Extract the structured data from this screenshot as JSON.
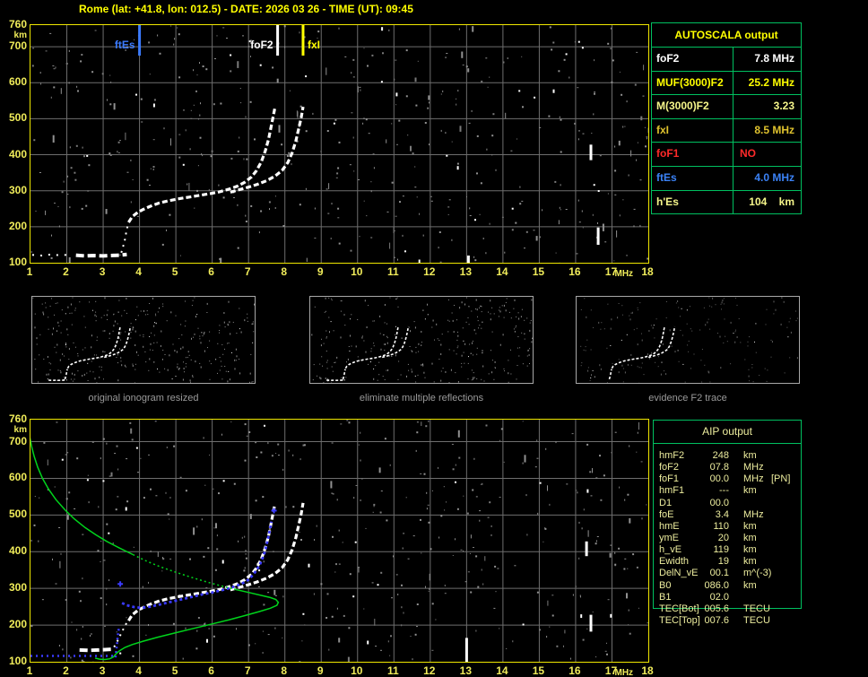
{
  "title": "Rome (lat: +41.8, lon: 012.5) - DATE: 2026 03 26 - TIME (UT): 09:45",
  "colors": {
    "accent_yellow": "#ffff00",
    "tick_yellow": "#f0ec5a",
    "plot_border_yellow": "#f0e800",
    "grid_gray": "#6e6e6e",
    "border_green": "#00c060",
    "pale_yellow": "#eded9e",
    "marker_blue": "#3b7bff",
    "trace_white": "#ffffff",
    "restored_blue": "#3a3aff",
    "profile_green": "#00d41c",
    "caption_gray": "#9a9a9a",
    "fof1_red": "#ff2a2a"
  },
  "autoscala": {
    "title": "AUTOSCALA output",
    "rows": [
      {
        "label": "foF2",
        "value": "7.8 MHz",
        "color": "#ffffff"
      },
      {
        "label": "MUF(3000)F2",
        "value": "25.2 MHz",
        "color": "#ffff00"
      },
      {
        "label": "M(3000)F2",
        "value": "3.23",
        "color": "#f5f58a"
      },
      {
        "label": "fxI",
        "value": "8.5 MHz",
        "color": "#dfc22e"
      },
      {
        "label": "foF1",
        "value": "NO",
        "color": "#ff2a2a"
      },
      {
        "label": "ftEs",
        "value": "4.0 MHz",
        "color": "#3b82f6"
      },
      {
        "label": "h'Es",
        "value": "104    km",
        "color": "#f5f58a"
      }
    ]
  },
  "thumbnails": [
    {
      "caption": "original ionogram resized"
    },
    {
      "caption": "eliminate multiple reflections"
    },
    {
      "caption": "evidence F2 trace"
    }
  ],
  "aip": {
    "title": "AIP output",
    "rows": [
      {
        "label": "hmF2",
        "value": "248",
        "unit": "km",
        "note": ""
      },
      {
        "label": "foF2",
        "value": "07.8",
        "unit": "MHz",
        "note": ""
      },
      {
        "label": "foF1",
        "value": "00.0",
        "unit": "MHz",
        "note": "[PN]"
      },
      {
        "label": "hmF1",
        "value": "---",
        "unit": "km",
        "note": ""
      },
      {
        "label": "D1",
        "value": "00.0",
        "unit": "",
        "note": ""
      },
      {
        "label": "foE",
        "value": "3.4",
        "unit": "MHz",
        "note": ""
      },
      {
        "label": "hmE",
        "value": "110",
        "unit": "km",
        "note": ""
      },
      {
        "label": "ymE",
        "value": "20",
        "unit": "km",
        "note": ""
      },
      {
        "label": "h_vE",
        "value": "119",
        "unit": "km",
        "note": ""
      },
      {
        "label": "Ewidth",
        "value": "19",
        "unit": "km",
        "note": ""
      },
      {
        "label": "DelN_vE",
        "value": "00.1",
        "unit": "m^(-3)",
        "note": ""
      },
      {
        "label": "B0",
        "value": "086.0",
        "unit": "km",
        "note": ""
      },
      {
        "label": "B1",
        "value": "02.0",
        "unit": "",
        "note": ""
      },
      {
        "label": "TEC[Bot]",
        "value": "005.6",
        "unit": "TECU",
        "note": ""
      },
      {
        "label": "TEC[Top]",
        "value": "007.6",
        "unit": "TECU",
        "note": ""
      }
    ]
  },
  "chart_data": [
    {
      "type": "scatter",
      "title": "recorded ionogram",
      "xlabel": "MHz",
      "ylabel": "km",
      "xlim": [
        1,
        18
      ],
      "ylim": [
        100,
        760
      ],
      "x_ticks": [
        1,
        2,
        3,
        4,
        5,
        6,
        7,
        8,
        9,
        10,
        11,
        12,
        13,
        14,
        15,
        16,
        17,
        18
      ],
      "y_ticks": [
        760,
        700,
        600,
        500,
        400,
        300,
        200,
        100
      ],
      "grid": true,
      "markers": [
        {
          "label": "ftEs",
          "freq": 4.0,
          "color": "#3b7bff",
          "label_side": "left"
        },
        {
          "label": "foF2",
          "freq": 7.8,
          "color": "#ffffff",
          "label_side": "left"
        },
        {
          "label": "fxI",
          "freq": 8.5,
          "color": "#ffff00",
          "label_side": "right"
        }
      ],
      "series": [
        {
          "name": "Es-sparse",
          "color": "#ffffff",
          "points": [
            [
              1.05,
              122
            ],
            [
              1.3,
              120
            ],
            [
              1.55,
              123
            ],
            [
              1.8,
              121
            ],
            [
              2.05,
              122
            ]
          ]
        },
        {
          "name": "Es-trace",
          "color": "#ffffff",
          "points": [
            [
              2.25,
              121
            ],
            [
              2.5,
              119
            ],
            [
              2.75,
              120
            ],
            [
              3.0,
              119
            ],
            [
              3.2,
              120
            ],
            [
              3.45,
              121
            ],
            [
              3.65,
              123
            ]
          ]
        },
        {
          "name": "Es-F-connector",
          "color": "#ffffff",
          "points": [
            [
              3.5,
              128
            ],
            [
              3.55,
              145
            ],
            [
              3.6,
              165
            ],
            [
              3.64,
              188
            ],
            [
              3.68,
              205
            ]
          ]
        },
        {
          "name": "F-trace-ordinary",
          "color": "#ffffff",
          "points": [
            [
              3.7,
              212
            ],
            [
              3.8,
              228
            ],
            [
              3.95,
              240
            ],
            [
              4.1,
              248
            ],
            [
              4.3,
              257
            ],
            [
              4.55,
              266
            ],
            [
              4.8,
              272
            ],
            [
              5.05,
              277
            ],
            [
              5.35,
              282
            ],
            [
              5.65,
              287
            ],
            [
              5.95,
              292
            ],
            [
              6.2,
              297
            ],
            [
              6.45,
              304
            ],
            [
              6.7,
              313
            ],
            [
              6.9,
              324
            ],
            [
              7.08,
              338
            ],
            [
              7.22,
              356
            ],
            [
              7.35,
              380
            ],
            [
              7.46,
              410
            ],
            [
              7.55,
              443
            ],
            [
              7.62,
              477
            ],
            [
              7.68,
              507
            ],
            [
              7.72,
              528
            ]
          ]
        },
        {
          "name": "F-trace-extraordinary",
          "color": "#ffffff",
          "points": [
            [
              6.5,
              296
            ],
            [
              6.75,
              303
            ],
            [
              7.0,
              310
            ],
            [
              7.25,
              318
            ],
            [
              7.5,
              328
            ],
            [
              7.72,
              340
            ],
            [
              7.92,
              356
            ],
            [
              8.08,
              378
            ],
            [
              8.2,
              405
            ],
            [
              8.3,
              438
            ],
            [
              8.38,
              472
            ],
            [
              8.45,
              503
            ],
            [
              8.5,
              533
            ]
          ]
        }
      ],
      "artifacts": [
        [
          16.42,
          385,
          428
        ],
        [
          16.62,
          150,
          198
        ],
        [
          13.05,
          96,
          120
        ]
      ]
    },
    {
      "type": "scatter",
      "title": "scaled ionogram with restored trace and electron density profile",
      "xlabel": "MHz",
      "ylabel": "km",
      "xlim": [
        1,
        18
      ],
      "ylim": [
        100,
        760
      ],
      "x_ticks": [
        1,
        2,
        3,
        4,
        5,
        6,
        7,
        8,
        9,
        10,
        11,
        12,
        13,
        14,
        15,
        16,
        17,
        18
      ],
      "y_ticks": [
        760,
        700,
        600,
        500,
        400,
        300,
        200,
        100
      ],
      "grid": true,
      "markers": [],
      "series": [
        {
          "name": "Es-trace",
          "color": "#ffffff",
          "points": [
            [
              2.35,
              132
            ],
            [
              2.6,
              131
            ],
            [
              2.85,
              132
            ],
            [
              3.05,
              133
            ],
            [
              3.25,
              134
            ]
          ]
        },
        {
          "name": "Es-F-connector",
          "color": "#ffffff",
          "points": [
            [
              3.3,
              140
            ],
            [
              3.4,
              158
            ],
            [
              3.5,
              178
            ],
            [
              3.6,
              198
            ],
            [
              3.66,
              208
            ]
          ]
        },
        {
          "name": "F-trace-ordinary",
          "color": "#ffffff",
          "points": [
            [
              3.7,
              212
            ],
            [
              3.8,
              228
            ],
            [
              3.95,
              240
            ],
            [
              4.1,
              248
            ],
            [
              4.3,
              257
            ],
            [
              4.55,
              266
            ],
            [
              4.8,
              272
            ],
            [
              5.05,
              277
            ],
            [
              5.35,
              282
            ],
            [
              5.65,
              287
            ],
            [
              5.95,
              292
            ],
            [
              6.2,
              297
            ],
            [
              6.45,
              304
            ],
            [
              6.7,
              313
            ],
            [
              6.9,
              324
            ],
            [
              7.08,
              338
            ],
            [
              7.22,
              356
            ],
            [
              7.35,
              380
            ],
            [
              7.46,
              410
            ],
            [
              7.55,
              443
            ],
            [
              7.62,
              477
            ],
            [
              7.68,
              507
            ],
            [
              7.72,
              528
            ]
          ]
        },
        {
          "name": "F-trace-extraordinary",
          "color": "#ffffff",
          "points": [
            [
              6.5,
              296
            ],
            [
              6.75,
              303
            ],
            [
              7.0,
              310
            ],
            [
              7.25,
              318
            ],
            [
              7.5,
              328
            ],
            [
              7.72,
              340
            ],
            [
              7.92,
              356
            ],
            [
              8.08,
              378
            ],
            [
              8.2,
              405
            ],
            [
              8.3,
              438
            ],
            [
              8.38,
              472
            ],
            [
              8.45,
              503
            ],
            [
              8.5,
              533
            ]
          ]
        },
        {
          "name": "restored-floor",
          "color": "#3a3aff",
          "points": [
            [
              1.0,
              116
            ],
            [
              3.28,
              116
            ]
          ]
        },
        {
          "name": "restored-rise",
          "color": "#3a3aff",
          "points": [
            [
              3.34,
              112
            ],
            [
              3.36,
              128
            ],
            [
              3.38,
              148
            ],
            [
              3.4,
              170
            ],
            [
              3.43,
              190
            ]
          ]
        },
        {
          "name": "restored-trace",
          "color": "#3a3aff",
          "points": [
            [
              3.52,
              260
            ],
            [
              3.65,
              254
            ],
            [
              3.85,
              249
            ],
            [
              4.05,
              247
            ],
            [
              4.3,
              250
            ],
            [
              4.55,
              256
            ],
            [
              4.85,
              263
            ],
            [
              5.15,
              270
            ],
            [
              5.45,
              277
            ],
            [
              5.75,
              284
            ],
            [
              6.05,
              290
            ],
            [
              6.3,
              296
            ],
            [
              6.55,
              303
            ],
            [
              6.8,
              312
            ],
            [
              7.0,
              324
            ],
            [
              7.15,
              340
            ],
            [
              7.3,
              362
            ],
            [
              7.42,
              390
            ],
            [
              7.5,
              420
            ],
            [
              7.57,
              452
            ],
            [
              7.63,
              482
            ]
          ]
        },
        {
          "name": "restored-points",
          "color": "#3a3aff",
          "points": [
            [
              3.47,
              312
            ],
            [
              7.7,
              512
            ]
          ]
        },
        {
          "name": "profile-topside",
          "color": "#00d41c",
          "points": [
            [
              0.98,
              712
            ],
            [
              1.03,
              688
            ],
            [
              1.1,
              660
            ],
            [
              1.2,
              630
            ],
            [
              1.33,
              600
            ],
            [
              1.5,
              570
            ],
            [
              1.7,
              542
            ],
            [
              1.95,
              514
            ],
            [
              2.2,
              490
            ],
            [
              2.5,
              466
            ],
            [
              2.8,
              446
            ],
            [
              3.1,
              428
            ],
            [
              3.45,
              410
            ],
            [
              3.82,
              392
            ]
          ]
        },
        {
          "name": "profile-middle",
          "color": "#00d41c",
          "points": [
            [
              3.82,
              392
            ],
            [
              4.2,
              374
            ],
            [
              4.6,
              358
            ],
            [
              5.0,
              344
            ],
            [
              5.4,
              331
            ],
            [
              5.8,
              319
            ],
            [
              6.2,
              308
            ],
            [
              6.6,
              298
            ]
          ]
        },
        {
          "name": "profile-bottomside",
          "color": "#00d41c",
          "points": [
            [
              6.6,
              298
            ],
            [
              7.0,
              289
            ],
            [
              7.35,
              281
            ],
            [
              7.6,
              275
            ],
            [
              7.75,
              270
            ],
            [
              7.82,
              262
            ],
            [
              7.78,
              254
            ],
            [
              7.6,
              246
            ],
            [
              7.3,
              237
            ],
            [
              6.9,
              226
            ],
            [
              6.45,
              214
            ],
            [
              5.95,
              202
            ],
            [
              5.45,
              190
            ],
            [
              4.95,
              178
            ],
            [
              4.5,
              167
            ],
            [
              4.1,
              156
            ],
            [
              3.8,
              147
            ],
            [
              3.6,
              139
            ],
            [
              3.45,
              130
            ],
            [
              3.35,
              121
            ],
            [
              3.28,
              113
            ],
            [
              3.18,
              108
            ],
            [
              3.05,
              106
            ],
            [
              2.9,
              107
            ],
            [
              2.78,
              110
            ]
          ]
        }
      ],
      "artifacts": [
        [
          16.3,
          388,
          428
        ],
        [
          16.42,
          182,
          228
        ],
        [
          13.0,
          100,
          165
        ]
      ]
    }
  ]
}
